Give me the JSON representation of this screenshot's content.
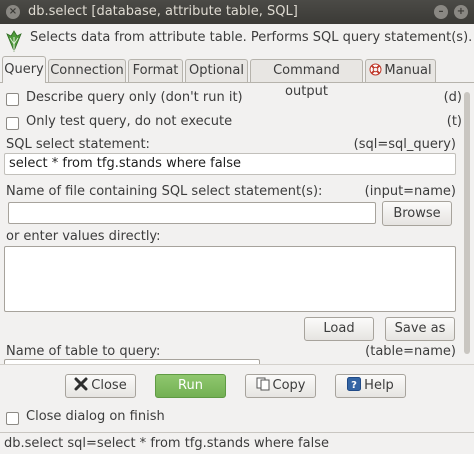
{
  "window": {
    "title": "db.select [database, attribute table, SQL]"
  },
  "header": {
    "description": "Selects data from attribute table. Performs SQL query statement(s)."
  },
  "tabs": [
    {
      "label": "Query"
    },
    {
      "label": "Connection"
    },
    {
      "label": "Format"
    },
    {
      "label": "Optional"
    },
    {
      "label": "Command output"
    },
    {
      "label": "Manual"
    }
  ],
  "query": {
    "describe_label": "Describe query only (don't run it)",
    "describe_key": "(d)",
    "test_label": "Only test query, do not execute",
    "test_key": "(t)",
    "sql_label": "SQL select statement:",
    "sql_key": "(sql=sql_query)",
    "sql_value": "select * from tfg.stands where false",
    "file_label": "Name of file containing SQL select statement(s):",
    "file_key": "(input=name)",
    "file_value": "",
    "browse_label": "Browse",
    "enter_label": "or enter values directly:",
    "enter_value": "",
    "load_label": "Load",
    "saveas_label": "Save as",
    "table_label": "Name of table to query:",
    "table_key": "(table=name)"
  },
  "actions": {
    "close_label": "Close",
    "run_label": "Run",
    "copy_label": "Copy",
    "help_label": "Help",
    "close_on_finish_label": "Close dialog on finish"
  },
  "status": {
    "text": "db.select sql=select * from tfg.stands where false"
  }
}
